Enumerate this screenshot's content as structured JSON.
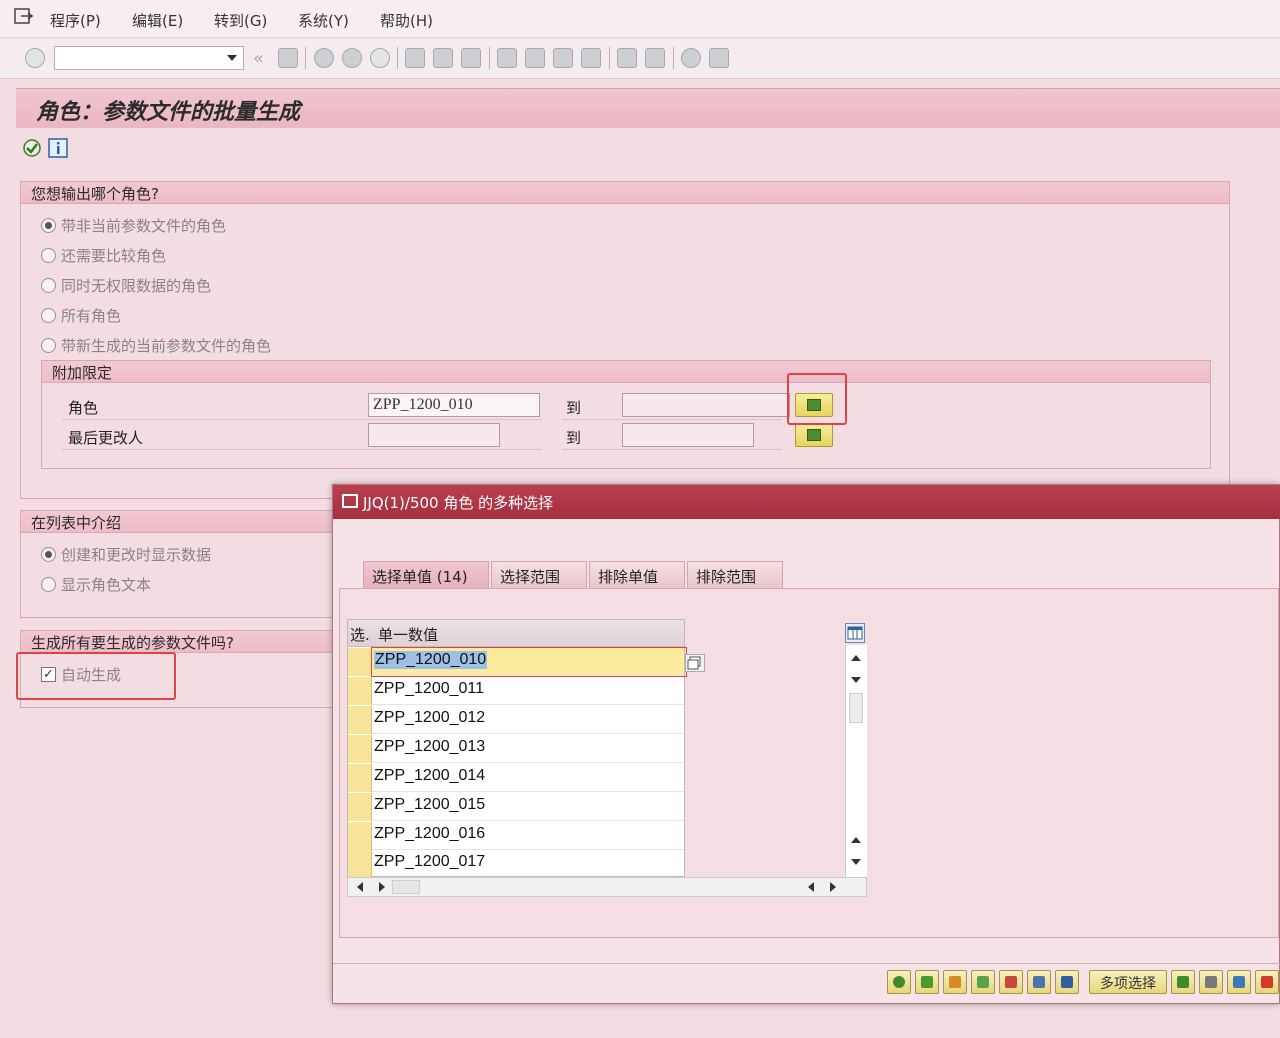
{
  "menubar": {
    "items": [
      "程序(P)",
      "编辑(E)",
      "转到(G)",
      "系统(Y)",
      "帮助(H)"
    ]
  },
  "toolbar": {
    "command_field_value": "",
    "back_symbol": "«"
  },
  "page": {
    "title": "角色：参数文件的批量生成"
  },
  "group_output": {
    "title": "您想输出哪个角色?",
    "options": [
      {
        "label": "带非当前参数文件的角色",
        "selected": true
      },
      {
        "label": "还需要比较角色",
        "selected": false
      },
      {
        "label": "同时无权限数据的角色",
        "selected": false
      },
      {
        "label": "所有角色",
        "selected": false
      },
      {
        "label": "带新生成的当前参数文件的角色",
        "selected": false
      }
    ],
    "extra": {
      "title": "附加限定",
      "rows": [
        {
          "label": "角色",
          "from": "ZPP_1200_010",
          "to_label": "到",
          "to": ""
        },
        {
          "label": "最后更改人",
          "from": "",
          "to_label": "到",
          "to": ""
        }
      ]
    }
  },
  "group_list": {
    "title": "在列表中介绍",
    "options": [
      {
        "label": "创建和更改时显示数据",
        "selected": true
      },
      {
        "label": "显示角色文本",
        "selected": false
      }
    ]
  },
  "group_generate": {
    "title": "生成所有要生成的参数文件吗?",
    "checkbox_label": "自动生成",
    "checked": true,
    "check_mark": "✓"
  },
  "dialog": {
    "title": "JJQ(1)/500 角色 的多种选择",
    "tabs": [
      "选择单值 (14)",
      "选择范围",
      "排除单值",
      "排除范围"
    ],
    "table": {
      "col_sel": "选.",
      "col_value": "单一数值",
      "rows": [
        "ZPP_1200_010",
        "ZPP_1200_011",
        "ZPP_1200_012",
        "ZPP_1200_013",
        "ZPP_1200_014",
        "ZPP_1200_015",
        "ZPP_1200_016",
        "ZPP_1200_017"
      ]
    },
    "footer": {
      "multi_select_label": "多项选择"
    }
  }
}
